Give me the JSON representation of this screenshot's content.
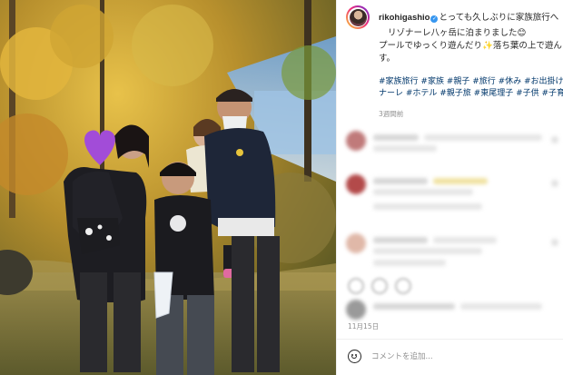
{
  "post": {
    "username": "rikohigashio",
    "caption_line1": "とっても久しぶりに家族旅行へ",
    "caption_line2": "リゾナーレ八ヶ岳に泊まりました😊",
    "caption_body": "プールでゆっくり遊んだり✨落ち葉の上で遊ん",
    "caption_body2": "す。",
    "hashtags_line1": "#家族旅行 #家族 #親子 #旅行 #休み #お出掛け",
    "hashtags_line2": "ナーレ #ホテル #親子旅 #東尾理子 #子供 #子育",
    "time_ago": "3週間前",
    "date": "11月15日"
  },
  "comment_box": {
    "placeholder": "コメントを追加..."
  },
  "colors": {
    "link": "#00376b",
    "verified": "#3897f0",
    "muted": "#8e8e8e"
  },
  "icons": {
    "verified": "verified-badge-icon",
    "emoji": "smile-icon",
    "face_cover": "purple-heart-icon"
  }
}
